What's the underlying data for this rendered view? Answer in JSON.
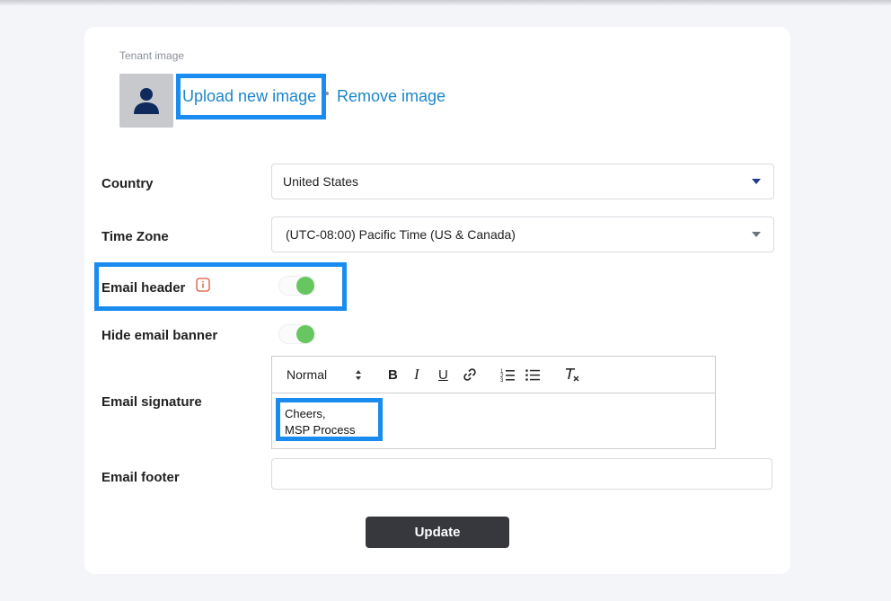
{
  "tenant": {
    "image_label": "Tenant image",
    "upload_label": "Upload new image",
    "remove_label": "Remove image"
  },
  "country": {
    "label": "Country",
    "value": "United States"
  },
  "timezone": {
    "label": "Time Zone",
    "value": "(UTC-08:00) Pacific Time (US & Canada)"
  },
  "email_header": {
    "label": "Email header",
    "enabled": true
  },
  "hide_banner": {
    "label": "Hide email banner",
    "enabled": true
  },
  "signature": {
    "label": "Email signature",
    "format": "Normal",
    "toolbar": [
      "bold-icon",
      "italic-icon",
      "underline-icon",
      "link-icon",
      "ordered-list-icon",
      "bullet-list-icon",
      "clear-format-icon"
    ],
    "lines": [
      "Cheers,",
      "MSP Process"
    ]
  },
  "footer": {
    "label": "Email footer",
    "value": ""
  },
  "update_label": "Update",
  "colors": {
    "link": "#1b86c9",
    "toggle_on": "#67c65f",
    "highlight": "#1a8cf0",
    "button": "#36383e"
  }
}
